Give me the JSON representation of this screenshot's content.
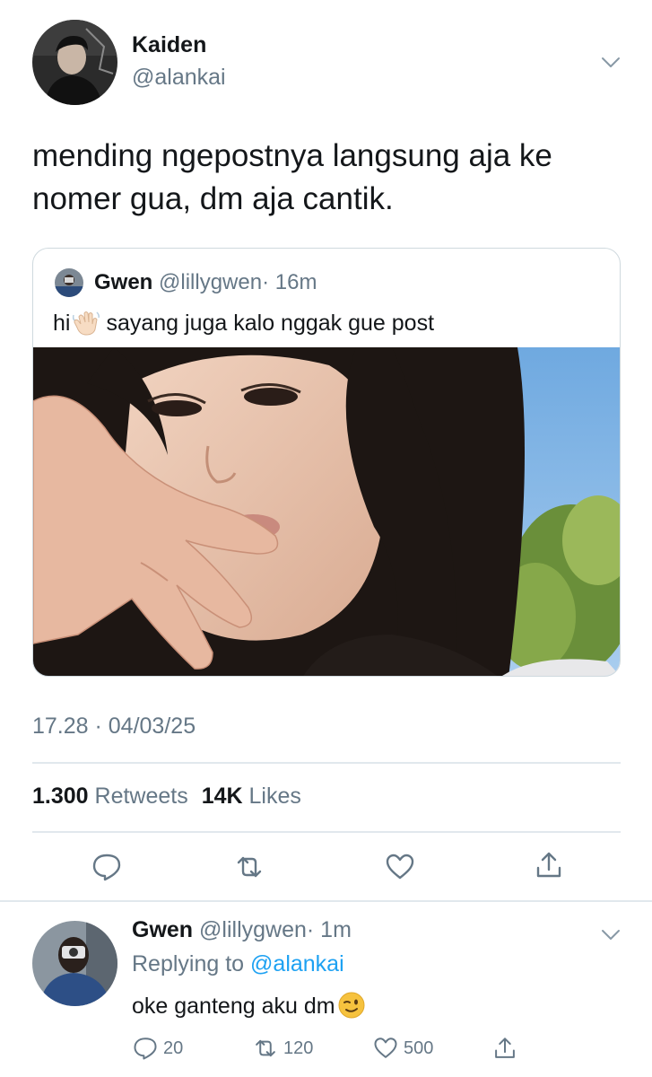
{
  "tweet": {
    "author_name": "Kaiden",
    "author_handle": "@alankai",
    "text": "mending ngepostnya langsung aja ke nomer gua, dm aja cantik.",
    "timestamp": "17.28 · 04/03/25",
    "retweets_count": "1.300",
    "retweets_label": "Retweets",
    "likes_count": "14K",
    "likes_label": "Likes"
  },
  "quoted_tweet": {
    "author_name": "Gwen",
    "author_handle": "@lillygwen",
    "time": "· 16m",
    "text_before_emoji": "hi",
    "emoji": "waving-hand",
    "text_after_emoji": "sayang juga kalo nggak gue post"
  },
  "reply": {
    "author_name": "Gwen",
    "author_handle": "@lillygwen",
    "time": "· 1m",
    "replying_prefix": "Replying to",
    "replying_to": "@alankai",
    "text": "oke ganteng aku dm",
    "emoji": "winking-face",
    "reply_count": "20",
    "retweet_count": "120",
    "like_count": "500"
  },
  "icons": {
    "reply": "reply-icon",
    "retweet": "retweet-icon",
    "like": "heart-icon",
    "share": "share-icon",
    "menu": "chevron-down-icon"
  },
  "colors": {
    "text": "#14171a",
    "muted": "#657786",
    "link": "#1da1f2",
    "divider": "#e1e8ed"
  }
}
